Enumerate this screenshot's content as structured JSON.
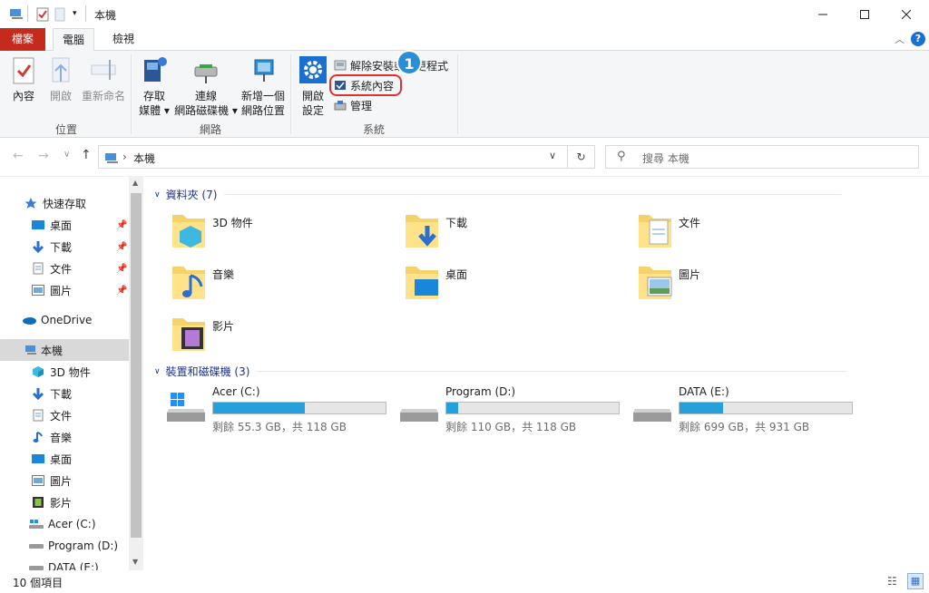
{
  "window": {
    "title": "本機"
  },
  "ribbon_tabs": {
    "file": "檔案",
    "computer": "電腦",
    "view": "檢視"
  },
  "ribbon": {
    "location": {
      "properties": "內容",
      "open": "開啟",
      "rename": "重新命名",
      "group": "位置"
    },
    "network": {
      "access_media_1": "存取",
      "access_media_2": "媒體",
      "map_drive_1": "連線",
      "map_drive_2": "網路磁碟機",
      "add_location_1": "新增一個",
      "add_location_2": "網路位置",
      "group": "網路"
    },
    "system": {
      "open_settings_1": "開啟",
      "open_settings_2": "設定",
      "uninstall": "解除安裝或變更程式",
      "system_properties": "系統內容",
      "manage": "管理",
      "group": "系統",
      "callout_number": "1"
    }
  },
  "address": {
    "path": "本機",
    "search_placeholder": "搜尋 本機"
  },
  "nav": {
    "quick_access": "快速存取",
    "qa_items": [
      "桌面",
      "下載",
      "文件",
      "圖片"
    ],
    "onedrive": "OneDrive",
    "this_pc": "本機",
    "pc_items": [
      "3D 物件",
      "下載",
      "文件",
      "音樂",
      "桌面",
      "圖片",
      "影片",
      "Acer (C:)",
      "Program (D:)",
      "DATA (E:)"
    ]
  },
  "content": {
    "folders_header": "資料夾 (7)",
    "folders": [
      "3D 物件",
      "下載",
      "文件",
      "音樂",
      "桌面",
      "圖片",
      "影片"
    ],
    "drives_header": "裝置和磁碟機 (3)",
    "drives": [
      {
        "name": "Acer (C:)",
        "free": "剩餘 55.3 GB，共 118 GB",
        "used_fraction": 0.53
      },
      {
        "name": "Program (D:)",
        "free": "剩餘 110 GB，共 118 GB",
        "used_fraction": 0.07
      },
      {
        "name": "DATA (E:)",
        "free": "剩餘 699 GB，共 931 GB",
        "used_fraction": 0.25
      }
    ]
  },
  "status": {
    "count": "10 個項目"
  },
  "colors": {
    "file_tab": "#c42b1c",
    "accent_blue": "#26a0da",
    "callout": "#2b8fd6",
    "highlight_ring": "#e0322b"
  }
}
